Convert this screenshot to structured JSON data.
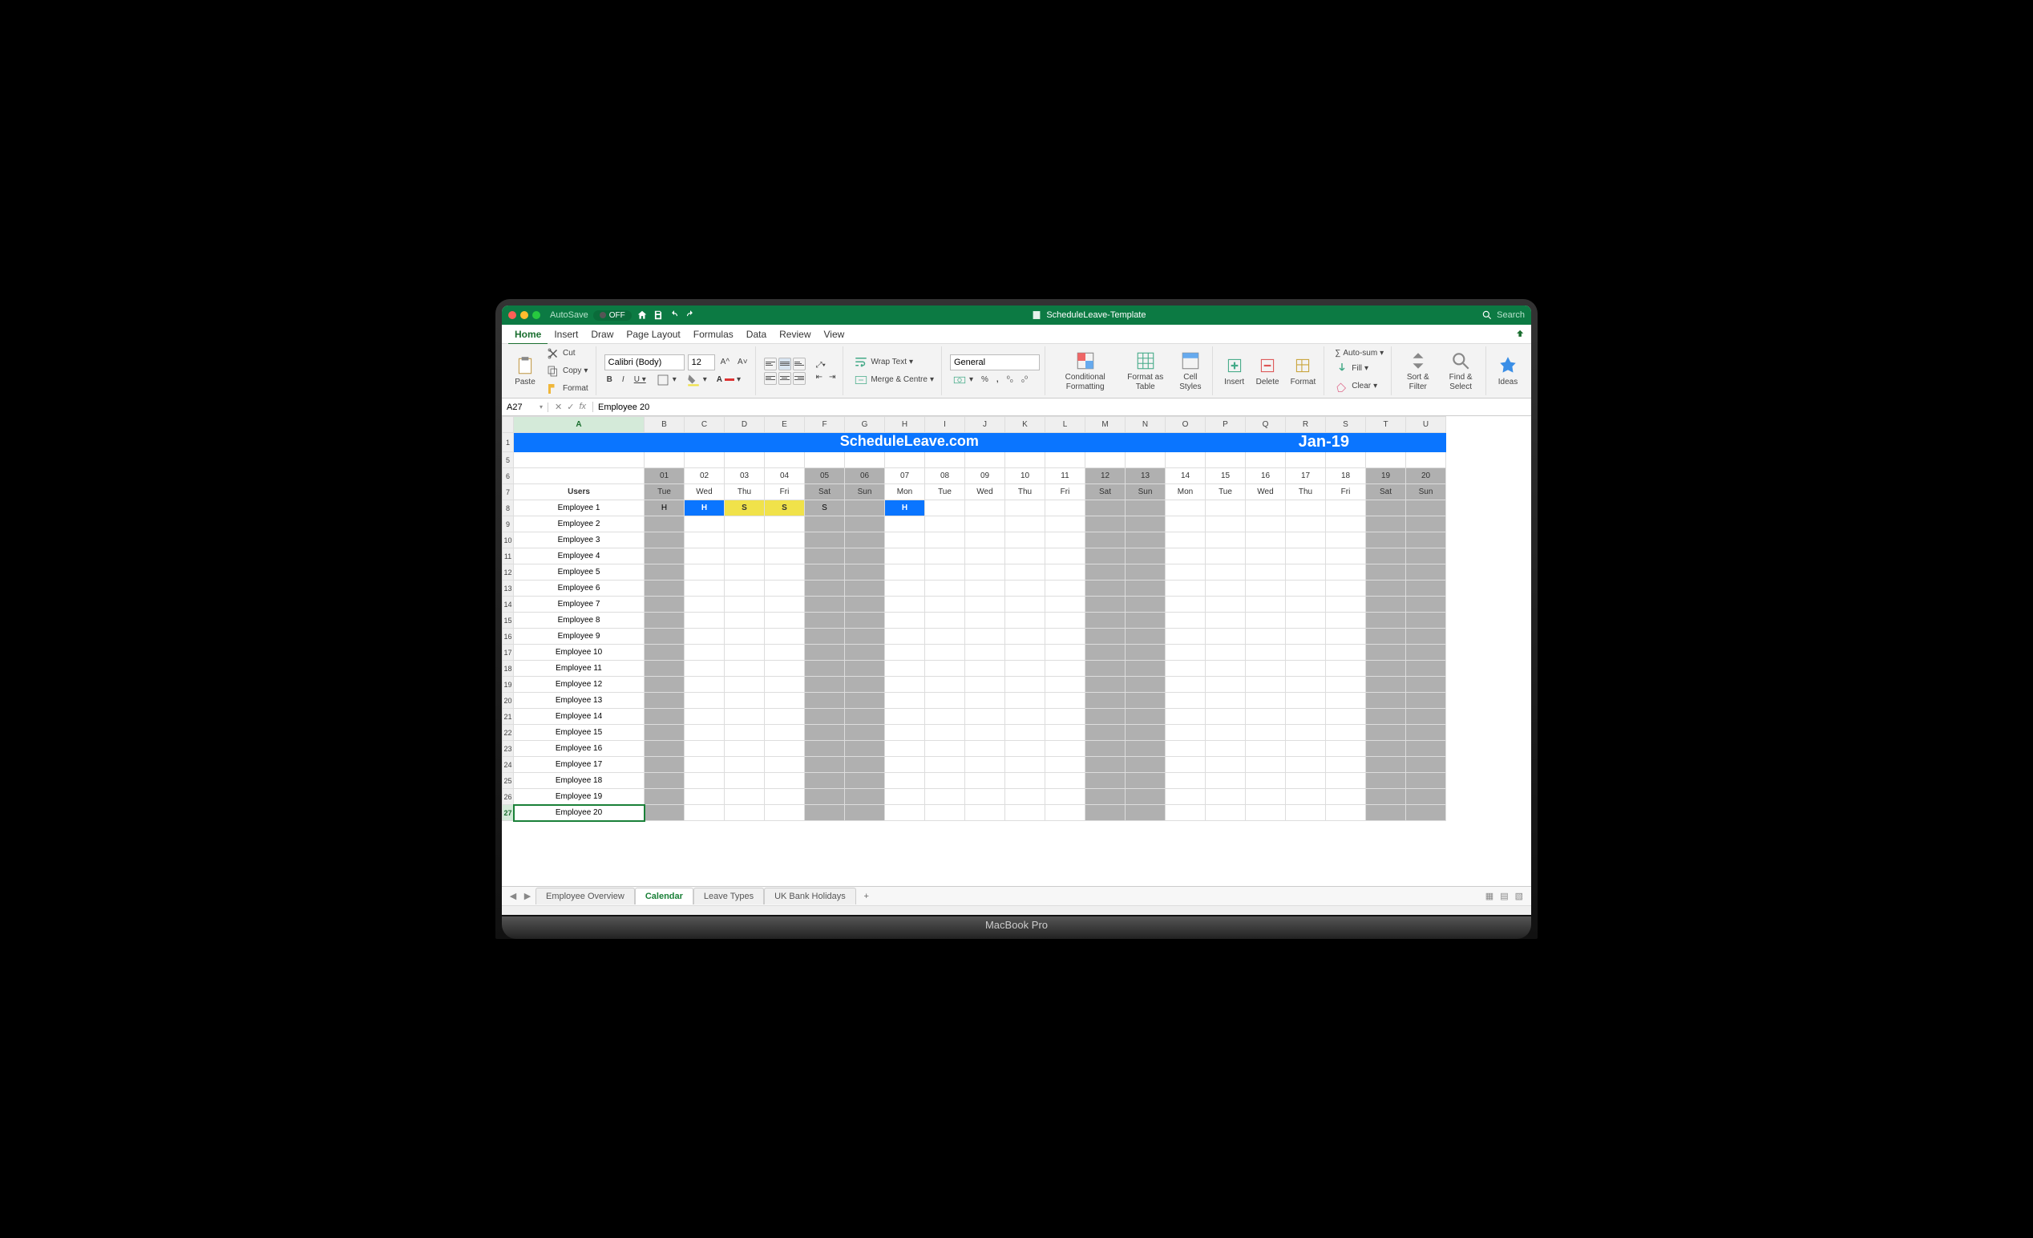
{
  "window": {
    "autosave_label": "AutoSave",
    "autosave_state": "OFF",
    "doc_title": "ScheduleLeave-Template",
    "search_placeholder": "Search"
  },
  "menu": {
    "tabs": [
      "Home",
      "Insert",
      "Draw",
      "Page Layout",
      "Formulas",
      "Data",
      "Review",
      "View"
    ],
    "active": "Home"
  },
  "ribbon": {
    "clipboard": {
      "paste": "Paste",
      "cut": "Cut",
      "copy": "Copy",
      "format": "Format"
    },
    "font": {
      "name": "Calibri (Body)",
      "size": "12"
    },
    "alignment": {
      "wrap": "Wrap Text",
      "merge": "Merge & Centre"
    },
    "number_format": "General",
    "cond_fmt": "Conditional Formatting",
    "fmt_table": "Format as Table",
    "cell_styles": "Cell Styles",
    "insert": "Insert",
    "delete": "Delete",
    "format": "Format",
    "autosum": "Auto-sum",
    "fill": "Fill",
    "clear": "Clear",
    "sortfilter": "Sort & Filter",
    "findselect": "Find & Select",
    "ideas": "Ideas"
  },
  "formula_bar": {
    "cell_ref": "A27",
    "fx": "fx",
    "value": "Employee 20"
  },
  "sheet": {
    "columns": [
      "A",
      "B",
      "C",
      "D",
      "E",
      "F",
      "G",
      "H",
      "I",
      "J",
      "K",
      "L",
      "M",
      "N",
      "O",
      "P",
      "Q",
      "R",
      "S",
      "T",
      "U"
    ],
    "selected_col": "A",
    "banner_title": "ScheduleLeave.com",
    "banner_month": "Jan-19",
    "dates": [
      "01",
      "02",
      "03",
      "04",
      "05",
      "06",
      "07",
      "08",
      "09",
      "10",
      "11",
      "12",
      "13",
      "14",
      "15",
      "16",
      "17",
      "18",
      "19",
      "20"
    ],
    "days": [
      "Tue",
      "Wed",
      "Thu",
      "Fri",
      "Sat",
      "Sun",
      "Mon",
      "Tue",
      "Wed",
      "Thu",
      "Fri",
      "Sat",
      "Sun",
      "Mon",
      "Tue",
      "Wed",
      "Thu",
      "Fri",
      "Sat",
      "Sun"
    ],
    "weekend_idx": [
      0,
      4,
      5,
      11,
      12,
      18,
      19
    ],
    "users_header": "Users",
    "employees": [
      "Employee 1",
      "Employee 2",
      "Employee 3",
      "Employee 4",
      "Employee 5",
      "Employee 6",
      "Employee 7",
      "Employee 8",
      "Employee 9",
      "Employee 10",
      "Employee 11",
      "Employee 12",
      "Employee 13",
      "Employee 14",
      "Employee 15",
      "Employee 16",
      "Employee 17",
      "Employee 18",
      "Employee 19",
      "Employee 20"
    ],
    "leave_row0": [
      {
        "v": "H",
        "cls": "gray"
      },
      {
        "v": "H",
        "cls": "blue-cell"
      },
      {
        "v": "S",
        "cls": "yellow-cell"
      },
      {
        "v": "S",
        "cls": "yellow-cell"
      },
      {
        "v": "S",
        "cls": "gray"
      },
      {
        "v": "",
        "cls": "gray"
      },
      {
        "v": "H",
        "cls": "blue-cell"
      },
      {
        "v": "",
        "cls": ""
      },
      {
        "v": "",
        "cls": ""
      },
      {
        "v": "",
        "cls": ""
      },
      {
        "v": "",
        "cls": ""
      },
      {
        "v": "",
        "cls": "gray"
      },
      {
        "v": "",
        "cls": "gray"
      },
      {
        "v": "",
        "cls": ""
      },
      {
        "v": "",
        "cls": ""
      },
      {
        "v": "",
        "cls": ""
      },
      {
        "v": "",
        "cls": ""
      },
      {
        "v": "",
        "cls": ""
      },
      {
        "v": "",
        "cls": "gray"
      },
      {
        "v": "",
        "cls": "gray"
      }
    ],
    "selected_row_idx": 19,
    "first_data_row_number": 8
  },
  "sheets": {
    "tabs": [
      "Employee Overview",
      "Calendar",
      "Leave Types",
      "UK Bank Holidays"
    ],
    "active": "Calendar"
  },
  "laptop": "MacBook Pro"
}
